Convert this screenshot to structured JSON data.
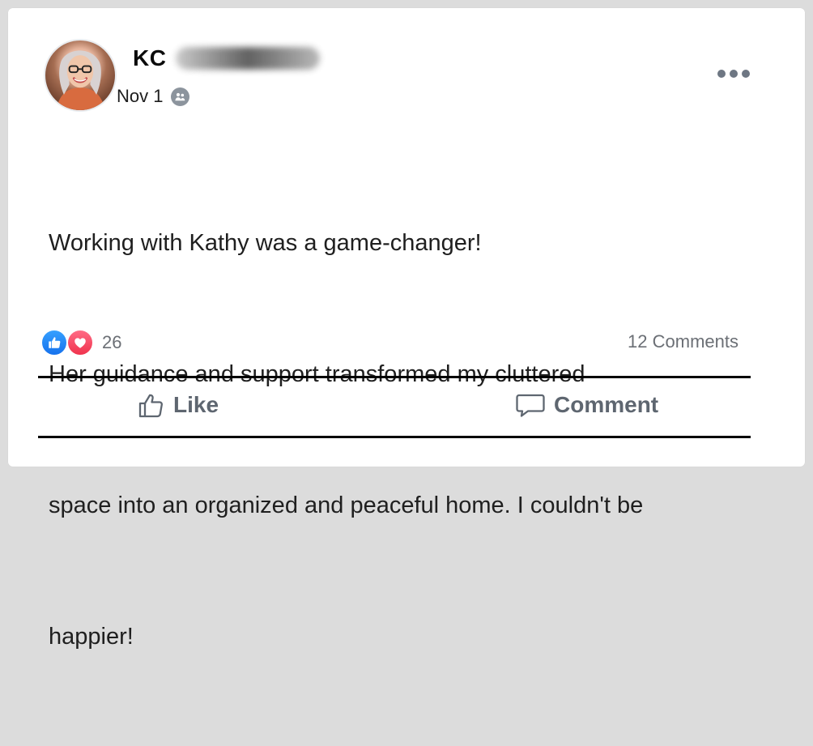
{
  "post": {
    "author_initials": "KC",
    "date": "Nov 1",
    "text_lines": [
      "Working with Kathy was a game-changer!",
      "Her guidance and support transformed my cluttered",
      "space into an organized and peaceful home. I couldn't be",
      "happier!"
    ]
  },
  "engagement": {
    "reaction_count": "26",
    "comments_label": "12 Comments"
  },
  "actions": {
    "like_label": "Like",
    "comment_label": "Comment"
  },
  "icons": {
    "privacy": "friends-icon",
    "menu": "more-options-icon",
    "like_reaction": "like-reaction-icon",
    "love_reaction": "love-reaction-icon",
    "like_button": "thumbs-up-icon",
    "comment_button": "comment-bubble-icon"
  },
  "colors": {
    "background": "#dcdcdc",
    "card": "#ffffff",
    "like_blue": "#1877f2",
    "love_red": "#f33e58",
    "muted_text": "#6b6f75",
    "action_gray": "#5e6670"
  }
}
